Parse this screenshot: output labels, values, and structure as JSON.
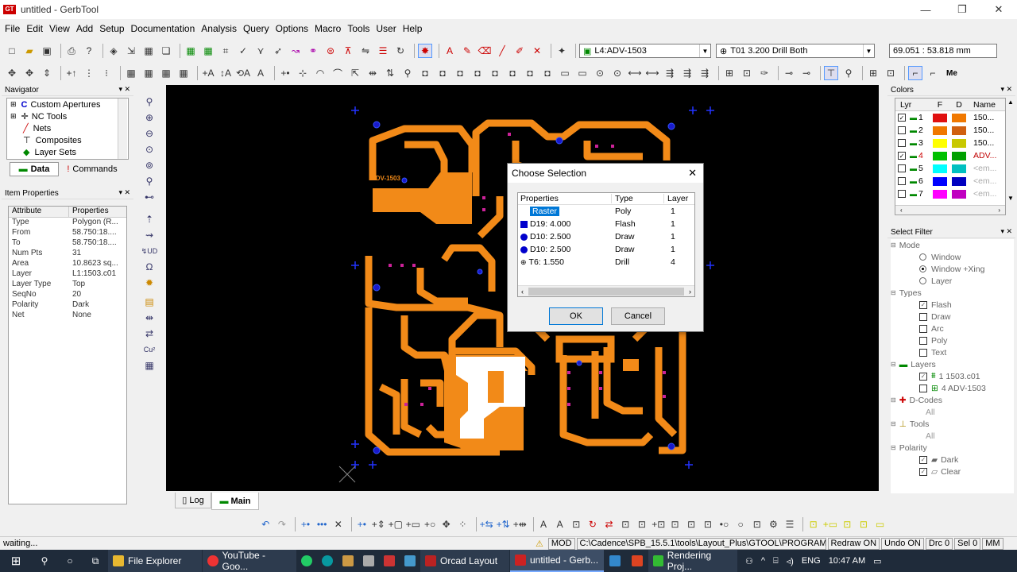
{
  "window": {
    "title": "untitled - GerbTool",
    "min": "—",
    "max": "❐",
    "close": "✕"
  },
  "menu": [
    "File",
    "Edit",
    "View",
    "Add",
    "Setup",
    "Documentation",
    "Analysis",
    "Query",
    "Options",
    "Macro",
    "Tools",
    "User",
    "Help"
  ],
  "toolbar": {
    "layer_combo": "L4:ADV-1503",
    "tool_combo": "T01 3.200 Drill Both",
    "coords": "69.051 : 53.818 mm",
    "me_label": "Me"
  },
  "navigator": {
    "title": "Navigator",
    "items": [
      "Custom Apertures",
      "NC Tools",
      "Nets",
      "Composites",
      "Layer Sets"
    ],
    "tab_data": "Data",
    "tab_commands": "Commands"
  },
  "item_properties": {
    "title": "Item Properties",
    "col_attr": "Attribute",
    "col_prop": "Properties",
    "rows": [
      [
        "Type",
        "Polygon (R..."
      ],
      [
        "From",
        "58.750:18...."
      ],
      [
        "To",
        "58.750:18...."
      ],
      [
        "Num Pts",
        "31"
      ],
      [
        "Area",
        "10.8623 sq..."
      ],
      [
        "Layer",
        "L1:1503.c01"
      ],
      [
        "Layer Type",
        "Top"
      ],
      [
        "SeqNo",
        "20"
      ],
      [
        "Polarity",
        "Dark"
      ],
      [
        "Net",
        "None"
      ]
    ]
  },
  "canvas": {
    "board_label": "ADV-1503"
  },
  "bottom_tabs": {
    "log": "Log",
    "main": "Main"
  },
  "dialog": {
    "title": "Choose Selection",
    "columns": [
      "Properties",
      "Type",
      "Layer"
    ],
    "rows": [
      {
        "prop": "Raster",
        "type": "Poly",
        "layer": "1",
        "icon": "none",
        "selected": true
      },
      {
        "prop": "D19: 4.000",
        "type": "Flash",
        "layer": "1",
        "icon": "square"
      },
      {
        "prop": "D10: 2.500",
        "type": "Draw",
        "layer": "1",
        "icon": "circle"
      },
      {
        "prop": "D10: 2.500",
        "type": "Draw",
        "layer": "1",
        "icon": "circle"
      },
      {
        "prop": "T6: 1.550",
        "type": "Drill",
        "layer": "4",
        "icon": "drill"
      }
    ],
    "ok": "OK",
    "cancel": "Cancel"
  },
  "colors_panel": {
    "title": "Colors",
    "columns": [
      "Lyr",
      "F",
      "D",
      "Name"
    ],
    "rows": [
      {
        "num": "1",
        "checked": true,
        "f": "#e01010",
        "d": "#f07800",
        "name": "150...",
        "name_color": "#000"
      },
      {
        "num": "2",
        "checked": false,
        "f": "#f07800",
        "d": "#d06010",
        "name": "150...",
        "name_color": "#000"
      },
      {
        "num": "3",
        "checked": false,
        "f": "#ffff00",
        "d": "#c8c800",
        "name": "150...",
        "name_color": "#000"
      },
      {
        "num": "4",
        "checked": true,
        "f": "#00c000",
        "d": "#00a000",
        "name": "ADV...",
        "name_color": "#c00000"
      },
      {
        "num": "5",
        "checked": false,
        "f": "#00ffff",
        "d": "#00c0c0",
        "name": "<em...",
        "name_color": "#aaa"
      },
      {
        "num": "6",
        "checked": false,
        "f": "#0000ff",
        "d": "#0000c0",
        "name": "<em...",
        "name_color": "#aaa"
      },
      {
        "num": "7",
        "checked": false,
        "f": "#ff00ff",
        "d": "#c000c0",
        "name": "<em...",
        "name_color": "#aaa"
      }
    ]
  },
  "select_filter": {
    "title": "Select Filter",
    "mode": "Mode",
    "mode_opts": [
      "Window",
      "Window +Xing",
      "Layer"
    ],
    "types": "Types",
    "type_opts": [
      [
        "Flash",
        true
      ],
      [
        "Draw",
        false
      ],
      [
        "Arc",
        false
      ],
      [
        "Poly",
        false
      ],
      [
        "Text",
        false
      ]
    ],
    "layers": "Layers",
    "layer_opts": [
      [
        "1 1503.c01",
        true
      ],
      [
        "4 ADV-1503",
        false
      ]
    ],
    "dcodes": "D-Codes",
    "dcodes_all": "All",
    "tools": "Tools",
    "tools_all": "All",
    "polarity": "Polarity",
    "polarity_opts": [
      [
        "Dark",
        true
      ],
      [
        "Clear",
        true
      ]
    ]
  },
  "status": {
    "left": "waiting...",
    "mod": "MOD",
    "path": "C:\\Cadence\\SPB_15.5.1\\tools\\Layout_Plus\\GTOOL\\PROGRAM",
    "redraw": "Redraw ON",
    "undo": "Undo ON",
    "drc": "Drc 0",
    "sel": "Sel 0",
    "units": "MM"
  },
  "taskbar": {
    "items": [
      "File Explorer",
      "YouTube - Goo...",
      "Orcad Layout",
      "untitled - Gerb...",
      "Rendering Proj..."
    ],
    "lang": "ENG",
    "time": "10:47 AM"
  }
}
